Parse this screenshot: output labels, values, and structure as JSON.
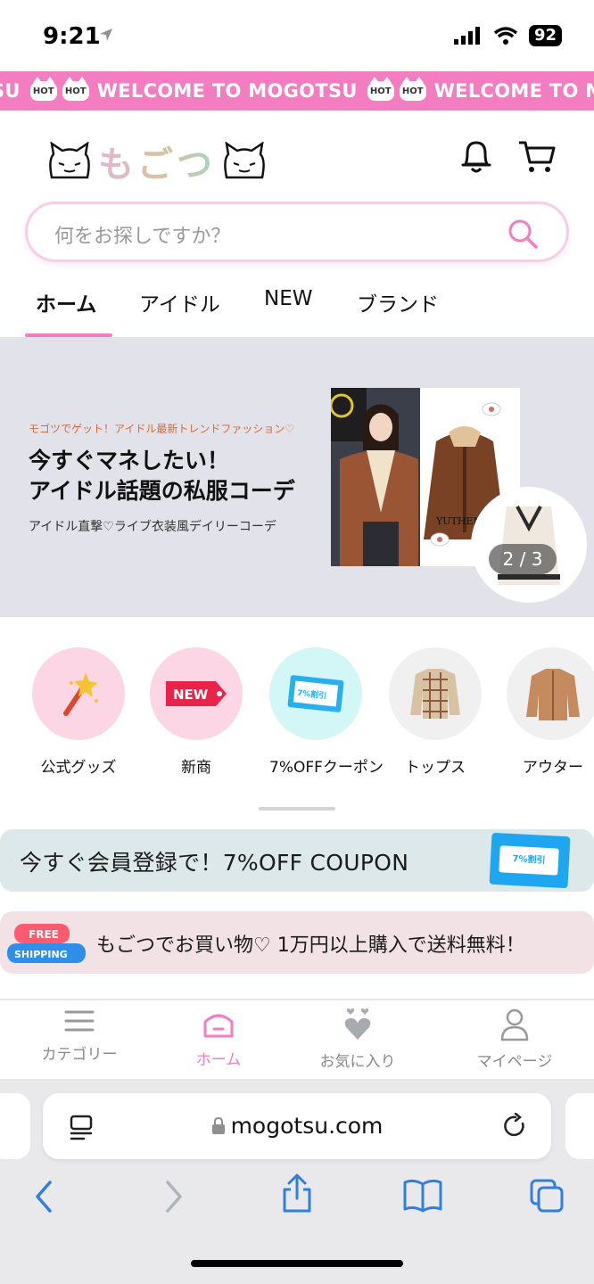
{
  "status_bar": {
    "time": "9:21",
    "battery": "92"
  },
  "ticker": {
    "text": "WELCOME TO MOGOTSU",
    "badge": "HOT",
    "prefix": "SU"
  },
  "header": {
    "logo_text": "もごつ"
  },
  "search": {
    "placeholder": "何をお探しですか？"
  },
  "tabs": [
    {
      "label": "ホーム",
      "active": true
    },
    {
      "label": "アイドル"
    },
    {
      "label": "NEW"
    },
    {
      "label": "ブランド"
    }
  ],
  "banner": {
    "kicker": "モゴツでゲット！アイドル最新トレンドファッション♡",
    "title_line1": "今すぐマネしたい！",
    "title_line2": "アイドル話題の私服コーデ",
    "subtitle": "アイドル直撃♡ライブ衣装風デイリーコーデ",
    "brand": "YUTHEN",
    "pager": "2 / 3"
  },
  "categories": [
    {
      "label": "公式グッズ"
    },
    {
      "label": "新商",
      "badge": "NEW"
    },
    {
      "label": "7%OFFクーポン",
      "coupon_text": "7%割引"
    },
    {
      "label": "トップス"
    },
    {
      "label": "アウター"
    }
  ],
  "promos": {
    "coupon_text": "今すぐ会員登録で！7%OFF COUPON",
    "coupon_badge": "7%割引",
    "shipping_text": "もごつでお買い物♡ 1万円以上購入で送料無料！",
    "free_badge_1": "FREE",
    "free_badge_2": "SHIPPING"
  },
  "bottom_nav": [
    {
      "label": "カテゴリー"
    },
    {
      "label": "ホーム",
      "active": true
    },
    {
      "label": "お気に入り"
    },
    {
      "label": "マイページ"
    }
  ],
  "browser": {
    "url": "mogotsu.com"
  },
  "colors": {
    "accent": "#f47cc0",
    "banner_bg": "#e2e2ea",
    "link_blue": "#2f7fe0"
  }
}
